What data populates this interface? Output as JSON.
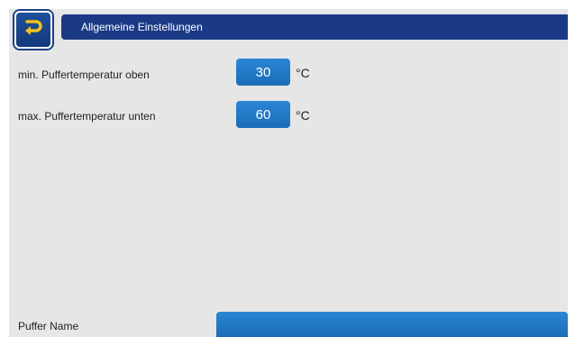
{
  "header": {
    "title": "Allgemeine Einstellungen",
    "back_icon": "return-arrow-icon"
  },
  "settings": [
    {
      "label": "min. Puffertemperatur oben",
      "value": "30",
      "unit": "°C"
    },
    {
      "label": "max. Puffertemperatur unten",
      "value": "60",
      "unit": "°C"
    }
  ],
  "name_field": {
    "label": "Puffer Name",
    "value": ""
  },
  "colors": {
    "title_bar": "#1b3a86",
    "value_box": "#1f78c8",
    "background": "#e6e6e6"
  }
}
